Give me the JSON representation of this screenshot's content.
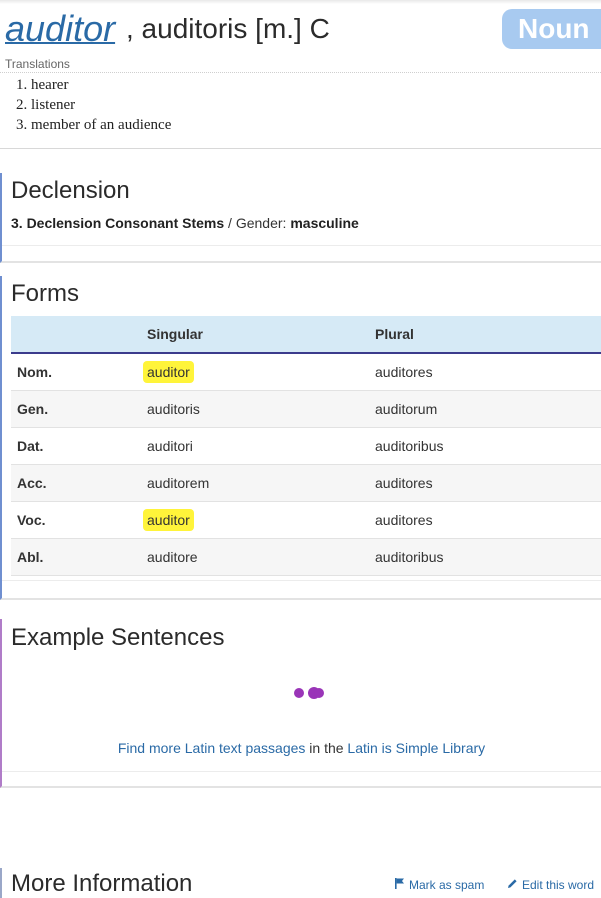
{
  "entry": {
    "lemma": "auditor",
    "forms_line": ", auditoris [m.] C",
    "badge": "Noun"
  },
  "translations": {
    "label": "Translations",
    "items": [
      "hearer",
      "listener",
      "member of an audience"
    ]
  },
  "declension": {
    "title": "Declension",
    "type": "3. Declension Consonant Stems",
    "separator": " / Gender: ",
    "gender": "masculine"
  },
  "forms": {
    "title": "Forms",
    "headers": [
      "",
      "Singular",
      "Plural"
    ],
    "rows": [
      {
        "case": "Nom.",
        "singular": "auditor",
        "plural": "auditores",
        "highlight": true
      },
      {
        "case": "Gen.",
        "singular": "auditoris",
        "plural": "auditorum",
        "highlight": false
      },
      {
        "case": "Dat.",
        "singular": "auditori",
        "plural": "auditoribus",
        "highlight": false
      },
      {
        "case": "Acc.",
        "singular": "auditorem",
        "plural": "auditores",
        "highlight": false
      },
      {
        "case": "Voc.",
        "singular": "auditor",
        "plural": "auditores",
        "highlight": true
      },
      {
        "case": "Abl.",
        "singular": "auditore",
        "plural": "auditoribus",
        "highlight": false
      }
    ]
  },
  "examples": {
    "title": "Example Sentences",
    "find_link": "Find more Latin text passages",
    "middle_text": " in the ",
    "library_link": "Latin is Simple Library"
  },
  "more_info": {
    "title": "More Information",
    "spam_label": "Mark as spam",
    "edit_label": "Edit this word"
  },
  "colors": {
    "link": "#2a6aa6",
    "badge": "#a8caf0",
    "highlight": "#fff43a",
    "loader": "#9a35b8",
    "table_header": "#d6eaf6"
  },
  "icons": {
    "loader": "loading-dots-icon",
    "spam": "flag-icon",
    "edit": "pencil-icon"
  }
}
